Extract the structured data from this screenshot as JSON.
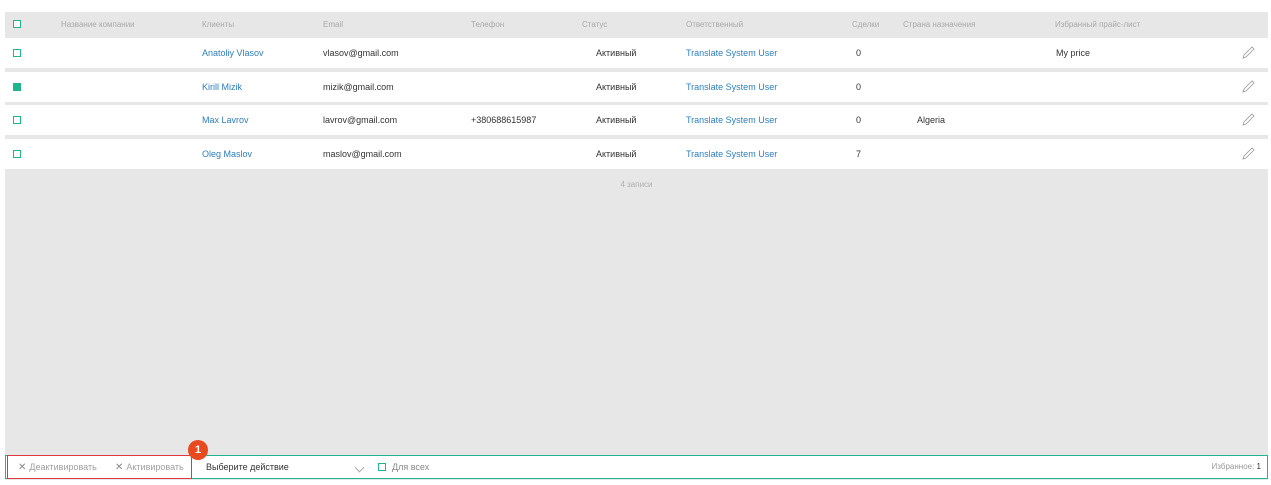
{
  "table": {
    "headers": {
      "company": "Название компании",
      "clients": "Клиенты",
      "email": "Email",
      "phone": "Телефон",
      "status": "Статус",
      "responsible": "Ответственный",
      "deals": "Сделки",
      "country": "Страна назначения",
      "pricelist": "Избранный прайс-лист"
    },
    "rows": [
      {
        "checked": false,
        "client": "Anatoliy Vlasov",
        "email": "vlasov@gmail.com",
        "phone": "",
        "status": "Активный",
        "responsible": "Translate System User",
        "deals": "0",
        "country": "",
        "pricelist": "My price"
      },
      {
        "checked": true,
        "client": "Kirill Mizik",
        "email": "mizik@gmail.com",
        "phone": "",
        "status": "Активный",
        "responsible": "Translate System User",
        "deals": "0",
        "country": "",
        "pricelist": ""
      },
      {
        "checked": false,
        "client": "Max Lavrov",
        "email": "lavrov@gmail.com",
        "phone": "+380688615987",
        "status": "Активный",
        "responsible": "Translate System User",
        "deals": "0",
        "country": "Algeria",
        "pricelist": ""
      },
      {
        "checked": false,
        "client": "Oleg Maslov",
        "email": "maslov@gmail.com",
        "phone": "",
        "status": "Активный",
        "responsible": "Translate System User",
        "deals": "7",
        "country": "",
        "pricelist": ""
      }
    ],
    "records_label": "4 записи"
  },
  "footer": {
    "deactivate_label": "Деактивировать",
    "activate_label": "Активировать",
    "action_select": "Выберите действие",
    "for_all_label": "Для всех",
    "favorites_label": "Избранное:",
    "favorites_count": "1"
  },
  "annotation": {
    "badge": "1"
  },
  "colors": {
    "accent": "#20b58f",
    "link": "#2d7fc1",
    "highlight": "#e0383e",
    "badge": "#e8491f"
  }
}
